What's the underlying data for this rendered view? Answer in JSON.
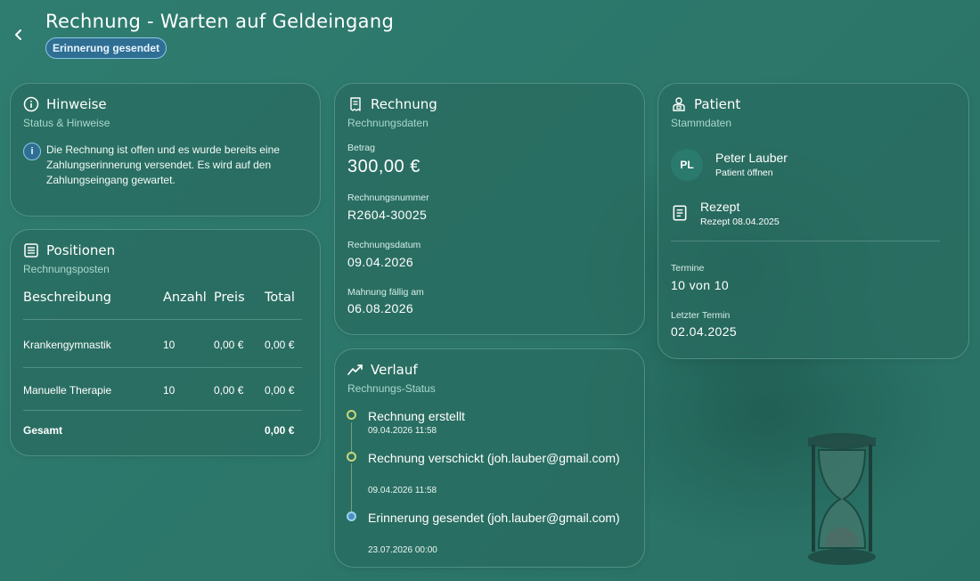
{
  "header": {
    "title": "Rechnung - Warten auf Geldeingang",
    "status_badge": "Erinnerung gesendet"
  },
  "hinweise": {
    "title": "Hinweise",
    "subtitle": "Status & Hinweise",
    "text": "Die Rechnung ist offen und es wurde bereits eine Zahlungserinnerung versendet. Es wird auf den Zahlungseingang gewartet."
  },
  "positionen": {
    "title": "Positionen",
    "subtitle": "Rechnungsposten",
    "columns": [
      "Beschreibung",
      "Anzahl",
      "Preis",
      "Total"
    ],
    "rows": [
      {
        "beschreibung": "Krankengymnastik",
        "anzahl": "10",
        "preis": "0,00 €",
        "total": "0,00 €"
      },
      {
        "beschreibung": "Manuelle Therapie",
        "anzahl": "10",
        "preis": "0,00 €",
        "total": "0,00 €"
      }
    ],
    "total_label": "Gesamt",
    "total_value": "0,00 €"
  },
  "rechnung": {
    "title": "Rechnung",
    "subtitle": "Rechnungsdaten",
    "betrag_label": "Betrag",
    "betrag": "300,00 €",
    "nummer_label": "Rechnungsnummer",
    "nummer": "R2604-30025",
    "datum_label": "Rechnungsdatum",
    "datum": "09.04.2026",
    "mahnung_label": "Mahnung fällig am",
    "mahnung": "06.08.2026"
  },
  "verlauf": {
    "title": "Verlauf",
    "subtitle": "Rechnungs-Status",
    "events": [
      {
        "title": "Rechnung erstellt",
        "time": "09.04.2026 11:58"
      },
      {
        "title": "Rechnung verschickt (joh.lauber@gmail.com)",
        "time": "09.04.2026 11:58"
      },
      {
        "title": "Erinnerung gesendet (joh.lauber@gmail.com)",
        "time": "23.07.2026 00:00"
      }
    ]
  },
  "patient": {
    "title": "Patient",
    "subtitle": "Stammdaten",
    "initials": "PL",
    "name": "Peter Lauber",
    "open_link": "Patient öffnen",
    "rezept_title": "Rezept",
    "rezept_sub": "Rezept 08.04.2025",
    "termine_label": "Termine",
    "termine": "10 von 10",
    "letzter_label": "Letzter Termin",
    "letzter": "02.04.2025"
  },
  "colors": {
    "background": "#2f7a6e",
    "card": "#296b60",
    "badge": "#2f6f93",
    "timeline_done": "#c8d77a",
    "timeline_current": "#4a90bf"
  }
}
